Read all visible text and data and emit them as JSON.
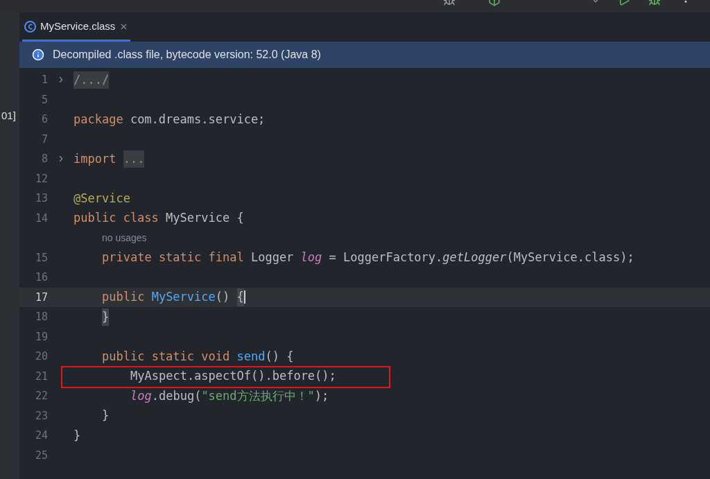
{
  "left_panel": {
    "text": "01]"
  },
  "tab": {
    "label": "MyService.class",
    "selected": true
  },
  "banner": {
    "text": "Decompiled .class file, bytecode version: 52.0 (Java 8)"
  },
  "lines": [
    {
      "kind": "top",
      "number": "1",
      "fold": true,
      "current": false,
      "boxed": false,
      "tokens": [
        {
          "kind": "folded",
          "text": "/.../"
        }
      ]
    },
    {
      "kind": "top",
      "number": "5",
      "fold": false,
      "current": false,
      "boxed": false
    },
    {
      "kind": "top",
      "number": "6",
      "fold": false,
      "current": false,
      "boxed": false,
      "tokens": [
        {
          "kind": "keyword",
          "text": "package"
        },
        {
          "kind": "plain",
          "text": " com.dreams.service;"
        }
      ]
    },
    {
      "kind": "top",
      "number": "7",
      "fold": false,
      "current": false,
      "boxed": false
    },
    {
      "kind": "top",
      "number": "8",
      "fold": true,
      "current": false,
      "boxed": false,
      "tokens": [
        {
          "kind": "keyword",
          "text": "import "
        },
        {
          "kind": "folded",
          "text": "..."
        }
      ]
    },
    {
      "kind": "top",
      "number": "12",
      "fold": false,
      "current": false,
      "boxed": false
    },
    {
      "kind": "top",
      "number": "13",
      "fold": false,
      "current": false,
      "boxed": false,
      "tokens": [
        {
          "kind": "annotation",
          "text": "@Service"
        }
      ]
    },
    {
      "kind": "top",
      "number": "14",
      "fold": false,
      "current": false,
      "boxed": false,
      "tokens": [
        {
          "kind": "keyword",
          "text": "public class"
        },
        {
          "kind": "plain",
          "text": " MyService {"
        }
      ]
    },
    {
      "kind": "hint",
      "text": "no usages"
    },
    {
      "kind": "member",
      "number": "15",
      "fold": false,
      "current": false,
      "boxed": false,
      "tokens": [
        {
          "kind": "keyword",
          "text": "private static final"
        },
        {
          "kind": "plain",
          "text": " Logger "
        },
        {
          "kind": "field",
          "text": "log"
        },
        {
          "kind": "plain",
          "text": " = LoggerFactory."
        },
        {
          "kind": "static",
          "text": "getLogger"
        },
        {
          "kind": "plain",
          "text": "(MyService.class);"
        }
      ]
    },
    {
      "kind": "top",
      "number": "16",
      "fold": false,
      "current": false,
      "boxed": false
    },
    {
      "kind": "member",
      "number": "17",
      "fold": false,
      "current": true,
      "boxed": false,
      "tokens": [
        {
          "kind": "keyword",
          "text": "public "
        },
        {
          "kind": "decl",
          "text": "MyService"
        },
        {
          "kind": "plain",
          "text": "() "
        },
        {
          "kind": "brace",
          "text": "{"
        }
      ]
    },
    {
      "kind": "member",
      "number": "18",
      "fold": false,
      "current": false,
      "boxed": false,
      "tokens": [
        {
          "kind": "brace",
          "text": "}"
        }
      ]
    },
    {
      "kind": "top",
      "number": "19",
      "fold": false,
      "current": false,
      "boxed": false
    },
    {
      "kind": "member",
      "number": "20",
      "fold": false,
      "current": false,
      "boxed": false,
      "tokens": [
        {
          "kind": "keyword",
          "text": "public static void "
        },
        {
          "kind": "decl",
          "text": "send"
        },
        {
          "kind": "plain",
          "text": "() {"
        }
      ]
    },
    {
      "kind": "statement",
      "number": "21",
      "fold": false,
      "current": false,
      "boxed": true,
      "tokens": [
        {
          "kind": "plain",
          "text": "MyAspect.aspectOf().before();"
        }
      ]
    },
    {
      "kind": "statement",
      "number": "22",
      "fold": false,
      "current": false,
      "boxed": false,
      "tokens": [
        {
          "kind": "field",
          "text": "log"
        },
        {
          "kind": "plain",
          "text": ".debug("
        },
        {
          "kind": "string",
          "text": "\"send方法执行中！\""
        },
        {
          "kind": "plain",
          "text": ");"
        }
      ]
    },
    {
      "kind": "member",
      "number": "23",
      "fold": false,
      "current": false,
      "boxed": false,
      "tokens": [
        {
          "kind": "plain",
          "text": "}"
        }
      ]
    },
    {
      "kind": "top",
      "number": "24",
      "fold": false,
      "current": false,
      "boxed": false,
      "tokens": [
        {
          "kind": "plain",
          "text": "}"
        }
      ]
    },
    {
      "kind": "top",
      "number": "25",
      "fold": false,
      "current": false,
      "boxed": false
    }
  ]
}
